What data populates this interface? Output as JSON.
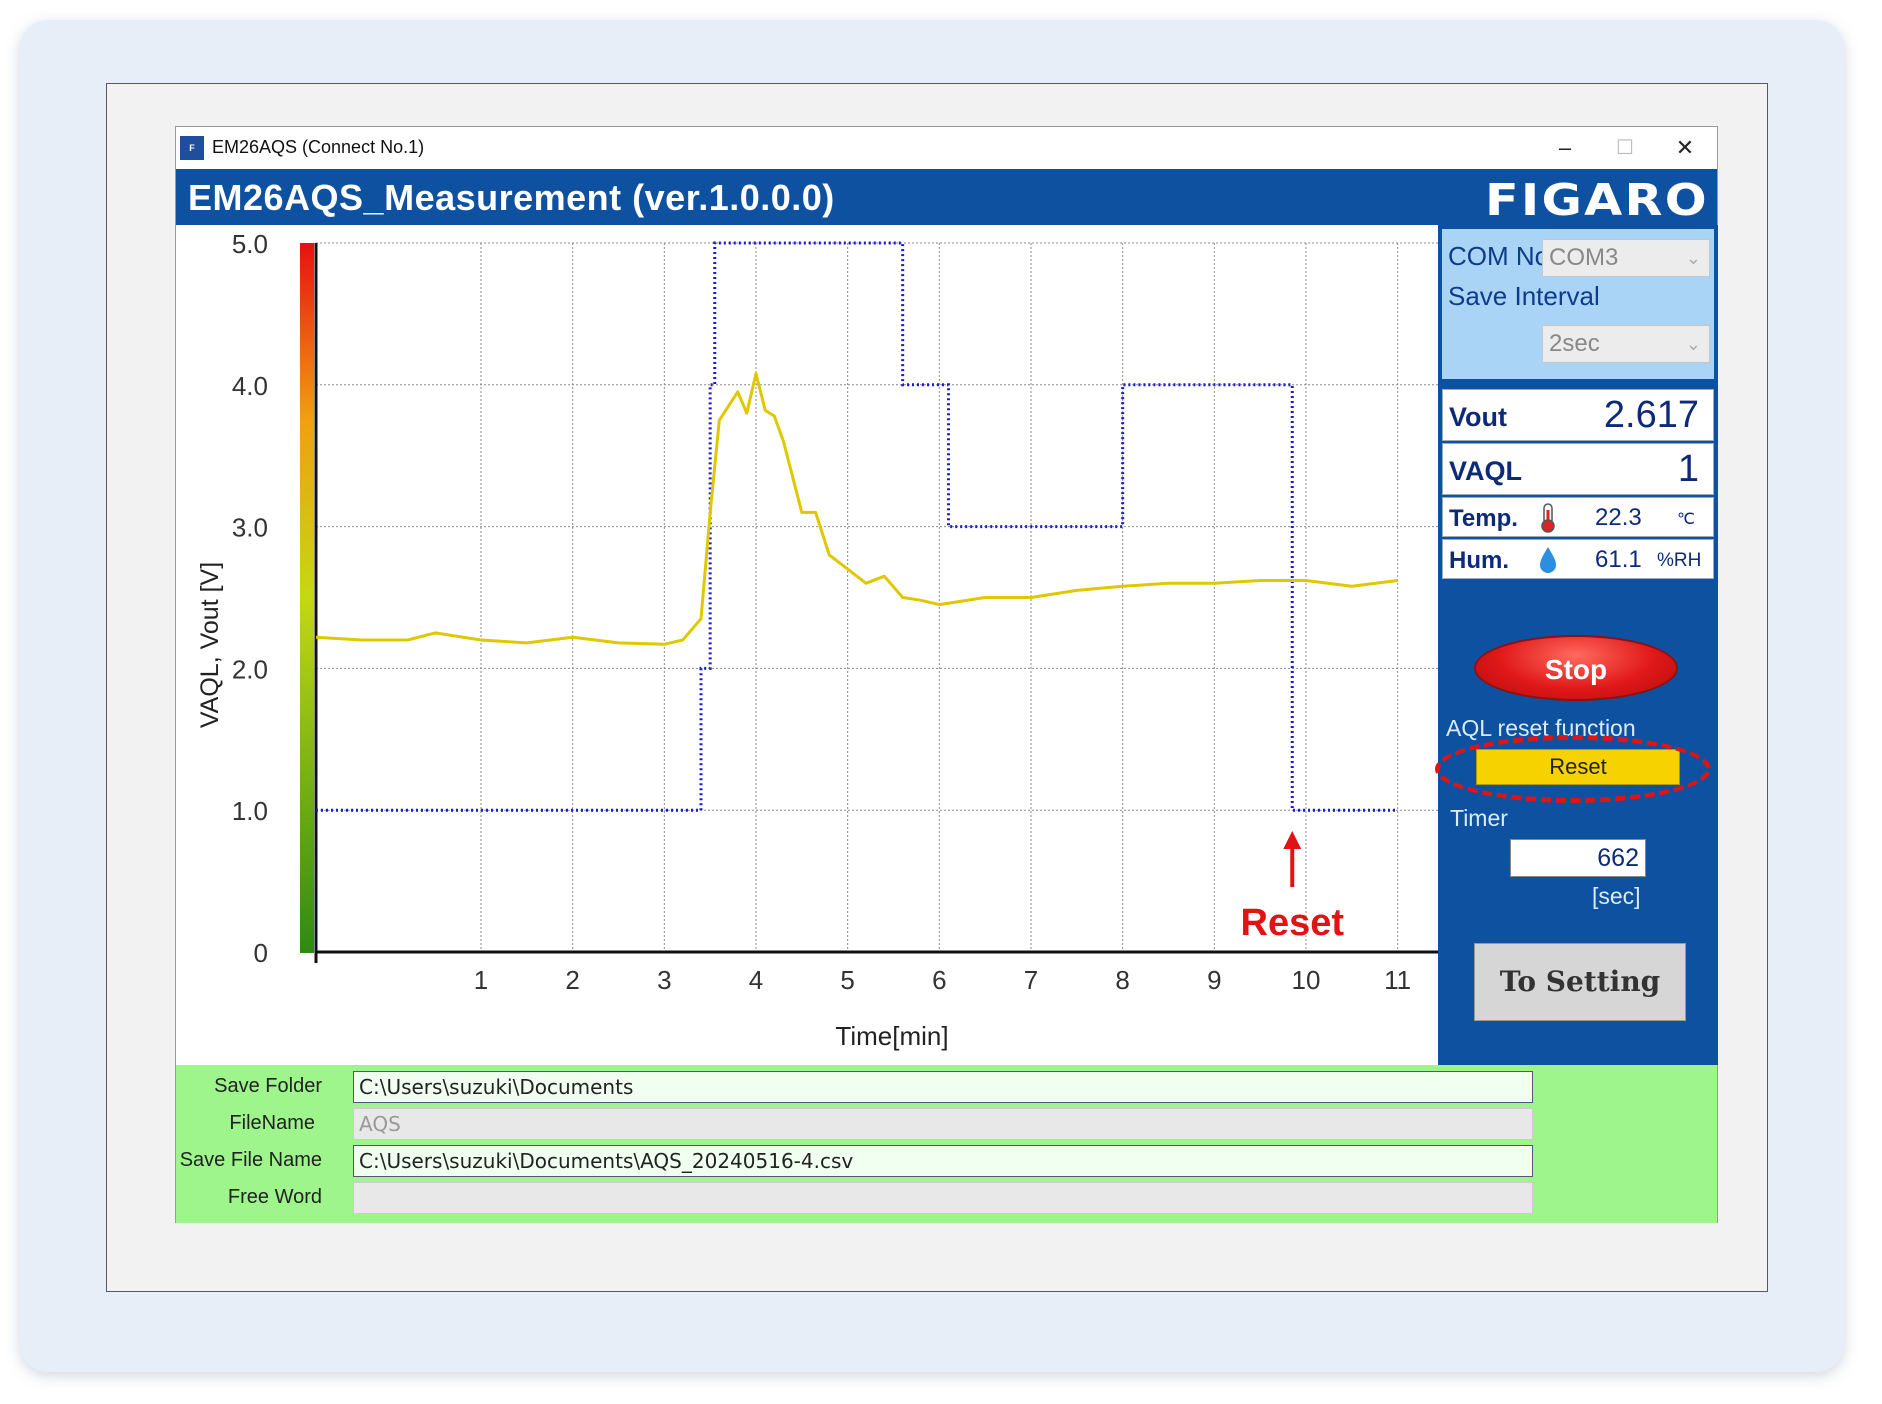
{
  "window": {
    "title": "EM26AQS (Connect  No.1)",
    "icon": "figaro-app-icon",
    "minimize": "–",
    "maximize": "☐",
    "close": "✕"
  },
  "header": {
    "title": "EM26AQS_Measurement (ver.1.0.0.0)",
    "brand": "FIGARO"
  },
  "settings": {
    "com_label": "COM No.",
    "com_value": "COM3",
    "interval_label": "Save Interval",
    "interval_value": "2sec"
  },
  "readings": {
    "vout_label": "Vout",
    "vout_value": "2.617",
    "vaql_label": "VAQL",
    "vaql_value": "1",
    "temp_label": "Temp.",
    "temp_value": "22.3",
    "temp_unit": "℃",
    "hum_label": "Hum.",
    "hum_value": "61.1",
    "hum_unit": "%RH"
  },
  "controls": {
    "stop_label": "Stop",
    "aql_reset_label": "AQL reset function",
    "reset_label": "Reset",
    "timer_label": "Timer",
    "timer_value": "662",
    "timer_unit": "[sec]",
    "to_setting_label": "To Setting"
  },
  "files": {
    "save_folder_label": "Save Folder",
    "save_folder_value": "C:\\Users\\suzuki\\Documents",
    "filename_label": "FileName",
    "filename_value": "AQS",
    "save_file_name_label": "Save File Name",
    "save_file_name_value": "C:\\Users\\suzuki\\Documents\\AQS_20240516-4.csv",
    "free_word_label": "Free Word",
    "free_word_value": ""
  },
  "annotation": {
    "reset_label": "Reset",
    "color": "#e01414"
  },
  "colors": {
    "header_blue": "#0e51a0",
    "vaql_line": "#1a1adb",
    "vout_line": "#e0c800",
    "footer_green": "#9ef58c",
    "reset_yellow": "#f5d200"
  },
  "chart_data": {
    "type": "line",
    "xlabel": "Time[min]",
    "ylabel": "VAQL,  Vout [V]",
    "xlim": [
      -0.8,
      11.2
    ],
    "ylim": [
      0,
      5.0
    ],
    "x_ticks": [
      "1",
      "2",
      "3",
      "4",
      "5",
      "6",
      "7",
      "8",
      "9",
      "10",
      "11"
    ],
    "y_ticks": [
      "0",
      "1.0",
      "2.0",
      "3.0",
      "4.0",
      "5.0"
    ],
    "grid": true,
    "series": [
      {
        "key": "vaql",
        "style": "step-dotted",
        "color": "#1a1adb",
        "x": [
          -0.8,
          3.4,
          3.5,
          3.55,
          5.6,
          6.1,
          8.0,
          9.85,
          11.0
        ],
        "y": [
          1,
          2,
          4,
          5,
          4,
          3,
          4,
          1,
          1
        ]
      },
      {
        "key": "vout",
        "style": "line",
        "color": "#e0c800",
        "x": [
          -0.8,
          -0.3,
          0.2,
          0.5,
          1.0,
          1.5,
          2.0,
          2.5,
          3.0,
          3.2,
          3.4,
          3.5,
          3.6,
          3.7,
          3.8,
          3.9,
          4.0,
          4.1,
          4.2,
          4.3,
          4.5,
          4.65,
          4.8,
          5.0,
          5.2,
          5.4,
          5.6,
          5.8,
          6.0,
          6.5,
          7.0,
          7.5,
          8.0,
          8.5,
          9.0,
          9.5,
          10.0,
          10.5,
          11.0
        ],
        "y": [
          2.22,
          2.2,
          2.2,
          2.25,
          2.2,
          2.18,
          2.22,
          2.18,
          2.17,
          2.2,
          2.35,
          3.1,
          3.75,
          3.85,
          3.95,
          3.8,
          4.08,
          3.82,
          3.78,
          3.6,
          3.1,
          3.1,
          2.8,
          2.7,
          2.6,
          2.65,
          2.5,
          2.48,
          2.45,
          2.5,
          2.5,
          2.55,
          2.58,
          2.6,
          2.6,
          2.62,
          2.62,
          2.58,
          2.62
        ]
      }
    ]
  }
}
